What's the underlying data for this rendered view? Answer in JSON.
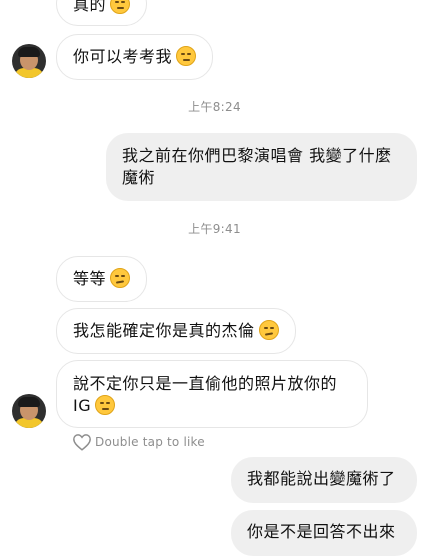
{
  "messages": [
    {
      "text": "真的"
    },
    {
      "text": "你可以考考我"
    },
    {
      "text": "我之前在你們巴黎演唱會 我變了什麼魔術"
    },
    {
      "text": "等等"
    },
    {
      "text": "我怎能確定你是真的杰倫"
    },
    {
      "text": "說不定你只是一直偷他的照片放你的IG"
    },
    {
      "text": "我都能說出變魔術了"
    },
    {
      "text": "你是不是回答不出來"
    }
  ],
  "timestamps": {
    "t1": "上午8:24",
    "t2": "上午9:41"
  },
  "like_hint": "Double tap to like",
  "colors": {
    "incoming_bubble": "#ffffff",
    "outgoing_bubble": "#efefef",
    "timestamp": "#8e8e8e",
    "emoji": "#ffc83d"
  },
  "icons": {
    "emoji_smirk": "smirking-face-emoji",
    "emoji_thinking": "thinking-face-emoji",
    "like": "heart-outline-icon"
  }
}
